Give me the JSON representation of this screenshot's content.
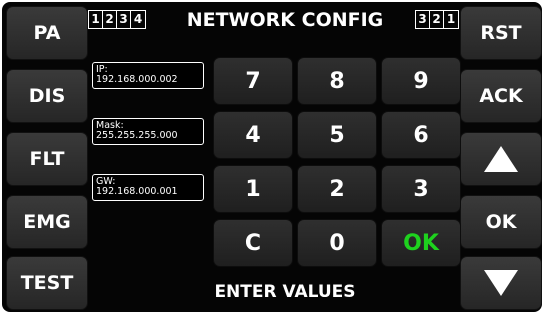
{
  "title": "NETWORK CONFIG",
  "footer": "ENTER VALUES",
  "left_buttons": [
    "PA",
    "DIS",
    "FLT",
    "EMG",
    "TEST"
  ],
  "right_buttons": {
    "rst": "RST",
    "ack": "ACK",
    "up_icon": "triangle-up-icon",
    "ok": "OK",
    "down_icon": "triangle-down-icon"
  },
  "index_left": [
    "1",
    "2",
    "3",
    "4"
  ],
  "index_right": [
    "3",
    "2",
    "1"
  ],
  "fields": {
    "ip": {
      "label": "IP:",
      "value": "192.168.000.002"
    },
    "mask": {
      "label": "Mask:",
      "value": "255.255.255.000"
    },
    "gw": {
      "label": "GW:",
      "value": "192.168.000.001"
    }
  },
  "keypad": [
    "7",
    "8",
    "9",
    "4",
    "5",
    "6",
    "1",
    "2",
    "3",
    "C",
    "0",
    "OK"
  ],
  "colors": {
    "ok_key": "#1ed21e",
    "background": "#050505",
    "button": "#2f2f2f"
  }
}
